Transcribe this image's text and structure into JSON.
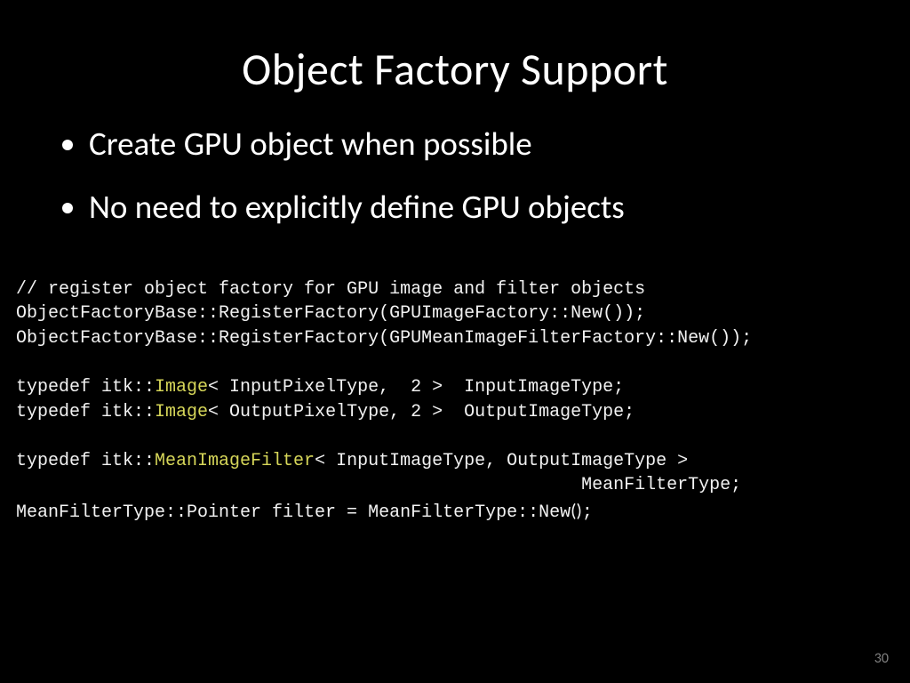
{
  "title": "Object Factory Support",
  "bullets": [
    "Create GPU object when possible",
    "No need to explicitly define GPU objects"
  ],
  "code": {
    "l1": "// register object factory for GPU image and filter objects",
    "l2": "ObjectFactoryBase::RegisterFactory(GPUImageFactory::New());",
    "l3": "ObjectFactoryBase::RegisterFactory(GPUMeanImageFilterFactory::New());",
    "l4": "",
    "l5a": "typedef itk::",
    "l5b": "Image",
    "l5c": "< InputPixelType,  2 >  InputImageType;",
    "l6a": "typedef itk::",
    "l6b": "Image",
    "l6c": "< OutputPixelType, 2 >  OutputImageType;",
    "l7": "",
    "l8a": "typedef itk::",
    "l8b": "MeanImageFilter",
    "l8c": "< InputImageType, OutputImageType >",
    "l9": "                                                     MeanFilterType;",
    "l10a": "MeanFilterType::Pointer filter = MeanFilterType::New",
    "l10b": "()",
    "l10c": ";"
  },
  "page": "30"
}
